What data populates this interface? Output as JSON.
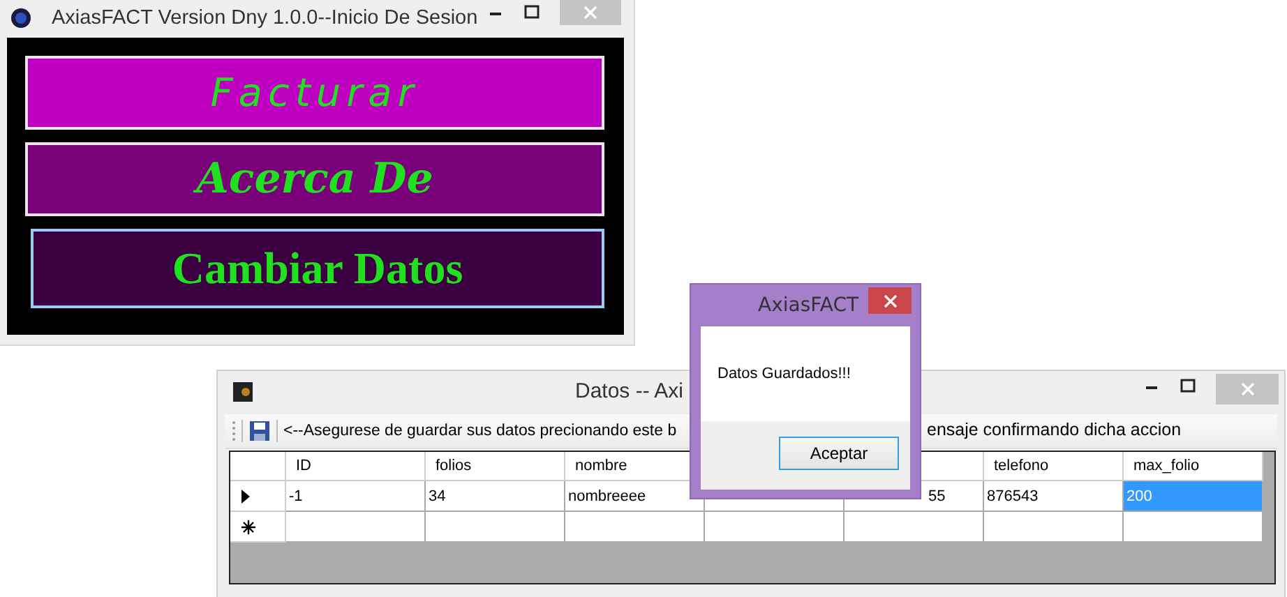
{
  "login_window": {
    "title": "AxiasFACT Version Dny 1.0.0--Inicio De Sesion",
    "buttons": [
      {
        "label": "Facturar",
        "kind": "wide-italic",
        "color": "#c000c0"
      },
      {
        "label": "Acerca De",
        "kind": "script",
        "color": "#7a007a"
      },
      {
        "label": "Cambiar Datos",
        "kind": "serif",
        "color": "#3a0040"
      }
    ]
  },
  "data_window": {
    "title": "Datos -- Axi",
    "toolbar_text": [
      "<--Asegurese de guardar sus datos precionando este b",
      "ensaje confirmando dicha accion"
    ],
    "columns": [
      {
        "label": "ID"
      },
      {
        "label": "folios"
      },
      {
        "label": "nombre"
      },
      {},
      {
        "kind": "blank"
      },
      {
        "label": "telefono"
      },
      {
        "label": "max_folio"
      }
    ],
    "rows": [
      {
        "kind": "current",
        "cells": [
          {
            "text": "-1",
            "selected": false
          },
          {
            "text": "34",
            "selected": false
          },
          {
            "text": "nombreeee",
            "selected": false
          },
          {},
          {
            "text": "55",
            "selected": false
          },
          {
            "text": "876543",
            "selected": false
          },
          {
            "text": "200",
            "selected": true
          }
        ]
      },
      {
        "kind": "new",
        "cells": []
      }
    ]
  },
  "dialog": {
    "title": "AxiasFACT",
    "message": "Datos Guardados!!!",
    "button": "Aceptar"
  }
}
